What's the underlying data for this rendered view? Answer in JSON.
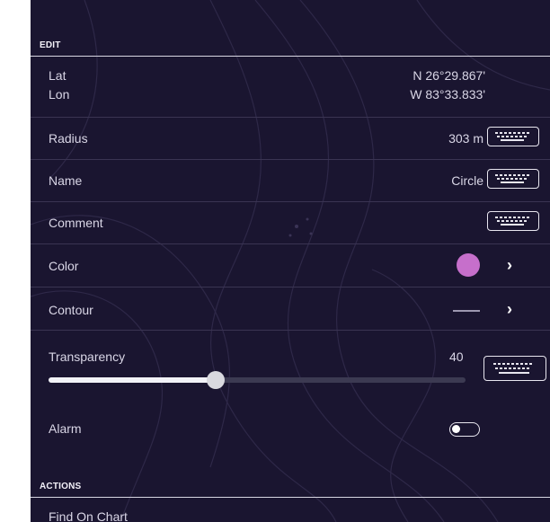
{
  "edit": {
    "header": "EDIT",
    "lat_label": "Lat",
    "lat_value": "N 26°29.867'",
    "lon_label": "Lon",
    "lon_value": "W 83°33.833'",
    "radius_label": "Radius",
    "radius_value": "303 m",
    "name_label": "Name",
    "name_value": "Circle",
    "comment_label": "Comment",
    "color_label": "Color",
    "color_value": "#c66fcb",
    "contour_label": "Contour",
    "transparency_label": "Transparency",
    "transparency_value": "40",
    "alarm_label": "Alarm",
    "alarm_on": false
  },
  "actions": {
    "header": "ACTIONS",
    "find_on_chart_label": "Find On Chart"
  },
  "icons": {
    "keyboard": "keyboard-icon",
    "chevron": "chevron-right-icon"
  },
  "colors": {
    "background": "#1a1530",
    "text": "#d9d6e6",
    "accent_swatch": "#c66fcb"
  }
}
